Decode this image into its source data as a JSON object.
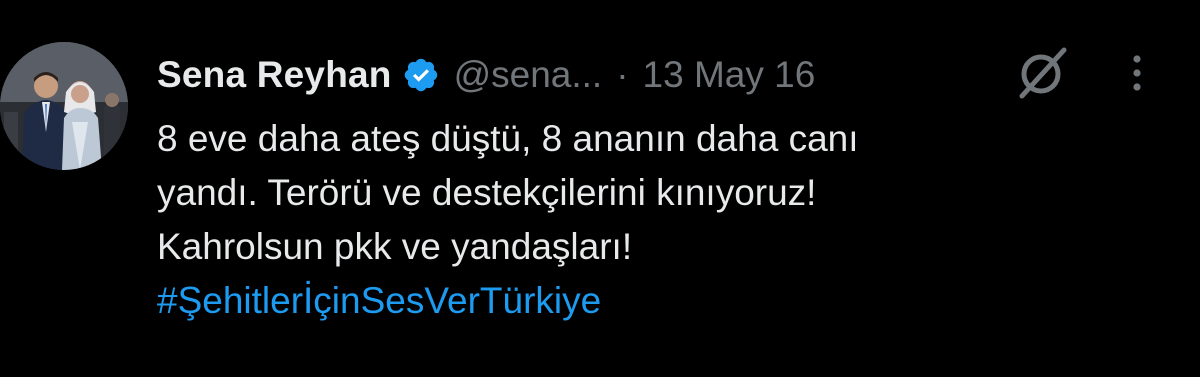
{
  "tweet": {
    "author": {
      "display_name": "Sena Reyhan",
      "handle": "@sena...",
      "verified": true,
      "avatar_icon": "profile-photo"
    },
    "separator": "·",
    "date": "13 May 16",
    "text_lines": [
      "8 eve daha ateş düştü, 8 ananın daha canı",
      "yandı. Terörü ve destekçilerini kınıyoruz!",
      "Kahrolsun pkk ve yandaşları!"
    ],
    "hashtag": "#ŞehitlerİçinSesVerTürkiye",
    "actions": {
      "grok_icon": "grok-icon",
      "more_icon": "more-options-icon"
    }
  },
  "colors": {
    "background": "#000000",
    "primary_text": "#e7e9ea",
    "secondary_text": "#71767b",
    "link": "#1d9bf0",
    "verified_badge": "#1d9bf0"
  }
}
